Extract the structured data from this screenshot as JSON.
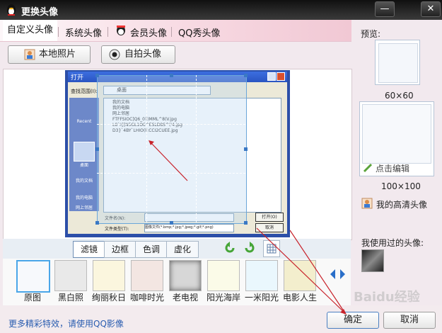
{
  "window": {
    "title": "更换头像",
    "min_symbol": "—",
    "close_symbol": "✕"
  },
  "tabs": [
    "自定义头像",
    "系统头像",
    "会员头像",
    "QQ秀头像"
  ],
  "actions": {
    "local_photo": "本地照片",
    "selfie": "自拍头像"
  },
  "embedded_dialog": {
    "title": "打开",
    "lookin_label": "查找范围(I):",
    "lookin_value": "桌面",
    "files": [
      "我的文档",
      "我的电脑",
      "网上邻居",
      "FTFFSIOC]Q6_0?)MML^8(V.jpg",
      "L8`I{[N5GL1O6^ESLD8S^('4.jpg",
      "D3}`4BY`LHIO(F:CCI2CUEE.jpg"
    ],
    "places": [
      "Recent",
      "桌面",
      "我的文档",
      "我的电脑",
      "网上邻居"
    ],
    "filename_label": "文件名(N):",
    "filetype_label": "文件类型(T):",
    "filetype_value": "图像文件(*.bmp;*.jpg;*.jpeg;*.gif;*.png)",
    "open_button": "打开(O)",
    "cancel_button": "取消"
  },
  "filter_tabs": [
    "滤镜",
    "边框",
    "色调",
    "虚化"
  ],
  "filters": [
    "原图",
    "黑白照",
    "绚丽秋日",
    "咖啡时光",
    "老电视",
    "阳光海岸",
    "一米阳光",
    "电影人生"
  ],
  "right": {
    "preview_label": "预览:",
    "size_60": "60×60",
    "size_100": "100×100",
    "click_edit": "点击编辑",
    "hd_avatar": "我的高清头像",
    "used_label": "我使用过的头像:"
  },
  "bottom": {
    "more_effects_link": "更多精彩特效，请使用QQ影像",
    "ok_button": "确定",
    "cancel_button": "取消"
  },
  "watermark": "Baidu经验"
}
